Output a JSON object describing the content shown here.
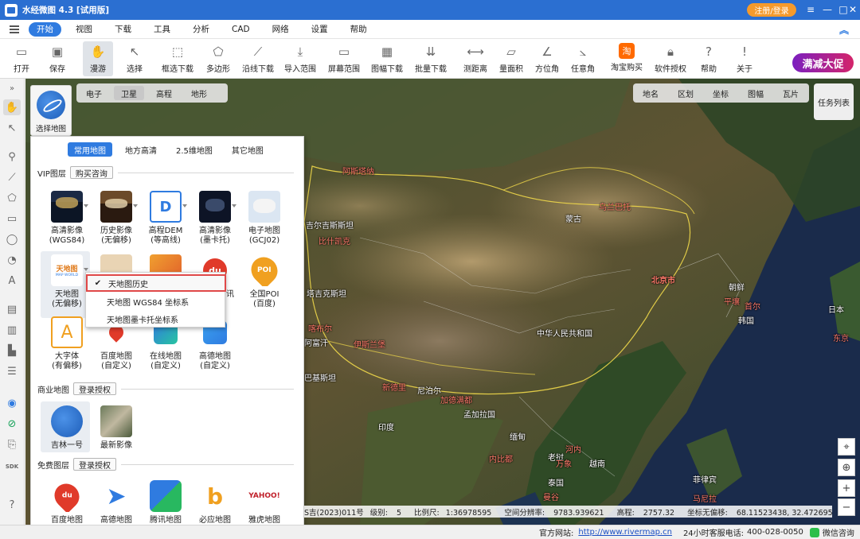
{
  "window": {
    "title": "水经微图 4.3 [试用版]",
    "login_label": "注册/登录"
  },
  "menu": {
    "items": [
      "开始",
      "视图",
      "下载",
      "工具",
      "分析",
      "CAD",
      "网络",
      "设置",
      "帮助"
    ],
    "active": "开始"
  },
  "toolbar": {
    "items": [
      {
        "label": "打开",
        "icon": "folder-icon"
      },
      {
        "label": "保存",
        "icon": "save-icon"
      },
      {
        "label": "漫游",
        "icon": "hand-icon"
      },
      {
        "label": "选择",
        "icon": "cursor-icon"
      },
      {
        "label": "框选下载",
        "icon": "box-download-icon"
      },
      {
        "label": "多边形",
        "icon": "polygon-icon"
      },
      {
        "label": "沿线下载",
        "icon": "line-download-icon"
      },
      {
        "label": "导入范围",
        "icon": "import-range-icon"
      },
      {
        "label": "屏幕范围",
        "icon": "screen-range-icon"
      },
      {
        "label": "图幅下载",
        "icon": "sheet-download-icon"
      },
      {
        "label": "批量下载",
        "icon": "batch-download-icon"
      },
      {
        "label": "测距离",
        "icon": "measure-distance-icon"
      },
      {
        "label": "量面积",
        "icon": "measure-area-icon"
      },
      {
        "label": "方位角",
        "icon": "azimuth-icon"
      },
      {
        "label": "任意角",
        "icon": "angle-icon"
      },
      {
        "label": "淘宝购买",
        "icon": "taobao-icon"
      },
      {
        "label": "软件授权",
        "icon": "lock-icon"
      },
      {
        "label": "帮助",
        "icon": "help-icon"
      },
      {
        "label": "关于",
        "icon": "info-icon"
      }
    ],
    "promo_label": "满减大促"
  },
  "map_type_chips": {
    "items": [
      "电子",
      "卫星",
      "高程",
      "地形"
    ],
    "active": "卫星"
  },
  "overlay_chips": {
    "items": [
      "地名",
      "区划",
      "坐标",
      "图幅",
      "瓦片"
    ]
  },
  "task_list_label": "任务列表",
  "select_map_label": "选择地图",
  "layer_panel": {
    "tabs": [
      "常用地图",
      "地方高清",
      "2.5维地图",
      "其它地图"
    ],
    "active_tab": "常用地图",
    "sections": {
      "vip": {
        "title": "VIP图层",
        "button": "购买咨询"
      },
      "commercial": {
        "title": "商业地图",
        "button": "登录授权"
      },
      "free": {
        "title": "免费图层",
        "button": "登录授权"
      }
    },
    "vip_tiles": [
      {
        "line1": "高清影像",
        "line2": "(WGS84)"
      },
      {
        "line1": "历史影像",
        "line2": "(无偏移)"
      },
      {
        "line1": "高程DEM",
        "line2": "(等高线)"
      },
      {
        "line1": "高清影像",
        "line2": "(墨卡托)"
      },
      {
        "line1": "电子地图",
        "line2": "(GCJ02)"
      },
      {
        "line1": "天地图",
        "line2": "(无偏移)"
      },
      {
        "line1": "",
        "line2": ""
      },
      {
        "line1": "",
        "line2": ""
      },
      {
        "line1": "",
        "line2": "讯"
      },
      {
        "line1": "全国POI",
        "line2": "(百度)"
      },
      {
        "line1": "大字体",
        "line2": "(有偏移)"
      },
      {
        "line1": "百度地图",
        "line2": "(自定义)"
      },
      {
        "line1": "在线地图",
        "line2": "(自定义)"
      },
      {
        "line1": "高德地图",
        "line2": "(自定义)"
      }
    ],
    "tile_icon_text": {
      "tianditu": "天地图",
      "tianditu_en": "MAP WORLD",
      "baidu": "du",
      "poi": "POI",
      "dem": "D",
      "yahoo": "YAHOO!"
    },
    "commercial_tiles": [
      {
        "line1": "吉林一号"
      },
      {
        "line1": "最新影像"
      }
    ],
    "free_tiles": [
      {
        "line1": "百度地图"
      },
      {
        "line1": "高德地图"
      },
      {
        "line1": "腾讯地图"
      },
      {
        "line1": "必应地图"
      },
      {
        "line1": "雅虎地图"
      }
    ]
  },
  "dropdown": {
    "items": [
      {
        "label": "天地图历史",
        "checked": true
      },
      {
        "label": "天地图 WGS84 坐标系",
        "checked": false
      },
      {
        "label": "天地图墨卡托坐标系",
        "checked": false
      }
    ],
    "check_mark": "✔"
  },
  "map_labels": [
    {
      "text": "阿斯塔纳",
      "color": "red"
    },
    {
      "text": "乌兰巴托",
      "color": "red"
    },
    {
      "text": "蒙古",
      "color": "white"
    },
    {
      "text": "吉尔吉斯斯坦",
      "color": "white"
    },
    {
      "text": "比什凯克",
      "color": "red"
    },
    {
      "text": "塔吉克斯坦",
      "color": "white"
    },
    {
      "text": "北京市",
      "color": "red"
    },
    {
      "text": "朝鲜",
      "color": "white"
    },
    {
      "text": "平壤",
      "color": "red"
    },
    {
      "text": "韩国",
      "color": "white"
    },
    {
      "text": "首尔",
      "color": "red"
    },
    {
      "text": "日本",
      "color": "white"
    },
    {
      "text": "东京",
      "color": "red"
    },
    {
      "text": "喀布尔",
      "color": "red"
    },
    {
      "text": "阿富汗",
      "color": "white"
    },
    {
      "text": "伊斯兰堡",
      "color": "red"
    },
    {
      "text": "中华人民共和国",
      "color": "white"
    },
    {
      "text": "新德里",
      "color": "red"
    },
    {
      "text": "巴基斯坦",
      "color": "white"
    },
    {
      "text": "尼泊尔",
      "color": "white"
    },
    {
      "text": "加德满都",
      "color": "red"
    },
    {
      "text": "孟加拉国",
      "color": "white"
    },
    {
      "text": "印度",
      "color": "white"
    },
    {
      "text": "缅甸",
      "color": "white"
    },
    {
      "text": "内比都",
      "color": "red"
    },
    {
      "text": "河内",
      "color": "red"
    },
    {
      "text": "老挝",
      "color": "white"
    },
    {
      "text": "万象",
      "color": "red"
    },
    {
      "text": "泰国",
      "color": "white"
    },
    {
      "text": "曼谷",
      "color": "red"
    },
    {
      "text": "菲律宾",
      "color": "white"
    },
    {
      "text": "马尼拉",
      "color": "red"
    },
    {
      "text": "越南",
      "color": "white"
    }
  ],
  "map_controls": [
    "locate-icon",
    "compass-icon",
    "zoom-in-icon",
    "zoom-out-icon"
  ],
  "info_bar": {
    "review_no": "S吉(2023)011号",
    "level_label": "级别:",
    "level_value": "5",
    "scale_label": "比例尺:",
    "scale_value": "1:36978595",
    "resolution_label": "空间分辨率:",
    "resolution_value": "9783.939621",
    "elevation_label": "高程:",
    "elevation_value": "2757.32",
    "coord_label": "坐标无偏移:",
    "coord_value": "68.11523438, 32.47269502"
  },
  "status_bar": {
    "website_label": "官方网站:",
    "website_url": "http://www.rivermap.cn",
    "hotline_label": "24小时客服电话:",
    "hotline": "400-028-0050",
    "wechat_label": "微信咨询"
  },
  "rail_label_sdk": "SDK"
}
